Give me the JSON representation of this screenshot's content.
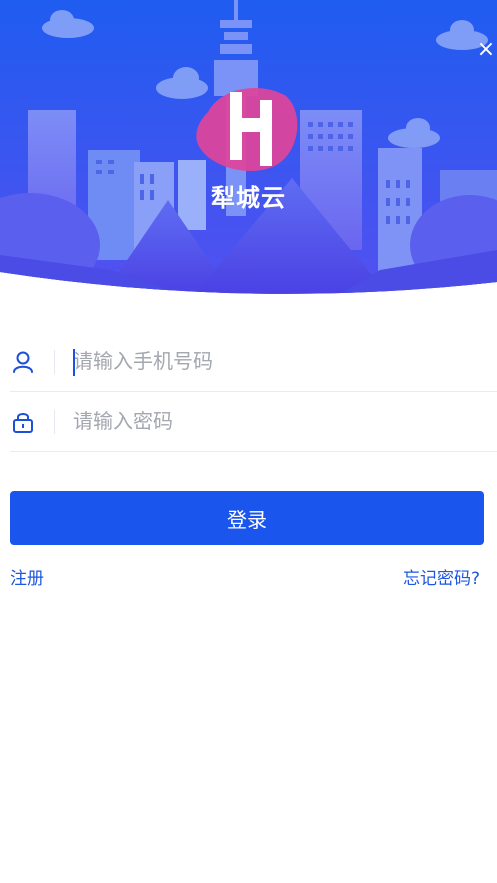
{
  "header": {
    "brand_name": "犁城云",
    "close_label": "×"
  },
  "form": {
    "phone_placeholder": "请输入手机号码",
    "password_placeholder": "请输入密码",
    "login_label": "登录",
    "register_label": "注册",
    "forgot_label": "忘记密码?"
  },
  "colors": {
    "primary": "#1a55ee",
    "banner_top": "#1f5ef0",
    "banner_bottom": "#5b4df0",
    "logo_accent": "#e0449a"
  },
  "icons": {
    "user": "user-icon",
    "lock": "lock-icon",
    "close": "close-icon"
  }
}
